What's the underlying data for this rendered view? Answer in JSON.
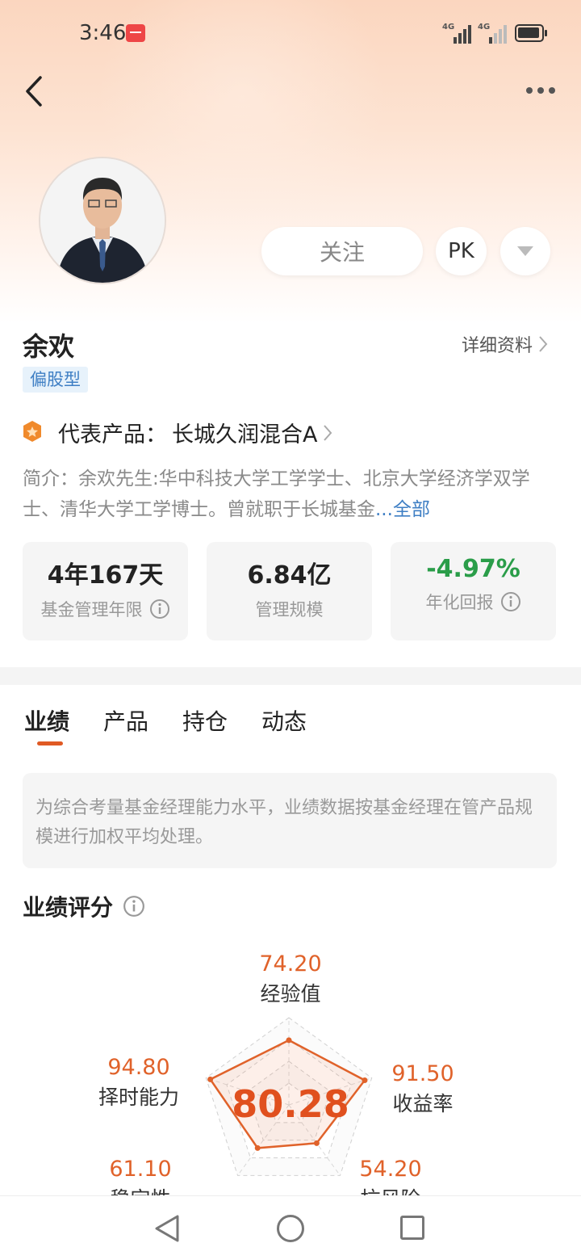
{
  "status_bar": {
    "time": "3:46",
    "network1": "4G",
    "network2": "4G"
  },
  "header": {
    "follow_label": "关注",
    "pk_label": "PK"
  },
  "manager": {
    "name": "余欢",
    "detail_link": "详细资料",
    "tag": "偏股型",
    "representative_prefix": "代表产品：",
    "representative_product": "长城久润混合A",
    "intro": "简介：余欢先生:华中科技大学工学学士、北京大学经济学双学士、清华大学工学博士。曾就职于长城基金",
    "intro_ellipsis": "...",
    "intro_more": "全部"
  },
  "stats": [
    {
      "value": "4年167天",
      "label": "基金管理年限"
    },
    {
      "value": "6.84亿",
      "label": "管理规模"
    },
    {
      "value": "-4.97%",
      "label": "年化回报"
    }
  ],
  "tabs": [
    "业绩",
    "产品",
    "持仓",
    "动态"
  ],
  "notice": "为综合考量基金经理能力水平，业绩数据按基金经理在管产品规模进行加权平均处理。",
  "score": {
    "title": "业绩评分",
    "total": "80.28",
    "dimensions": [
      {
        "label": "经验值",
        "value": "74.20"
      },
      {
        "label": "收益率",
        "value": "91.50"
      },
      {
        "label": "抗风险",
        "value": "54.20"
      },
      {
        "label": "稳定性",
        "value": "61.10"
      },
      {
        "label": "择时能力",
        "value": "94.80"
      }
    ]
  },
  "colors": {
    "accent": "#e05a24",
    "link": "#3f7fc4",
    "positive": "#2a9d49",
    "tag_bg": "#e7f2fb"
  }
}
